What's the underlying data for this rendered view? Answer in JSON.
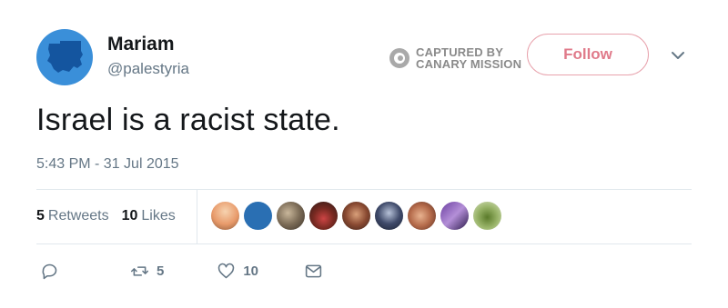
{
  "user": {
    "name": "Mariam",
    "handle": "@palestyria"
  },
  "watermark": {
    "line1": "CAPTURED BY",
    "line2": "CANARY MISSION"
  },
  "follow_label": "Follow",
  "tweet": {
    "text": "Israel is a racist state.",
    "timestamp": "5:43 PM - 31 Jul 2015"
  },
  "stats": {
    "retweets_count": "5",
    "retweets_label": "Retweets",
    "likes_count": "10",
    "likes_label": "Likes"
  },
  "actions": {
    "retweet_count": "5",
    "like_count": "10"
  },
  "colors": {
    "avatar_bg": "#3a8fd9",
    "follow_accent": "#e07a8a",
    "muted_text": "#657786"
  }
}
